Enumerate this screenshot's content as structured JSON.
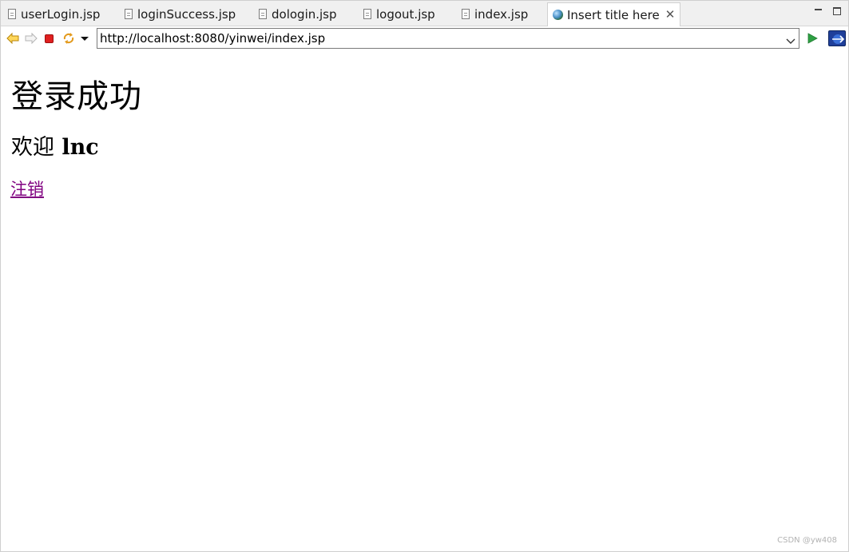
{
  "tabs": [
    {
      "label": "userLogin.jsp",
      "icon": "jsp-file-icon"
    },
    {
      "label": "loginSuccess.jsp",
      "icon": "jsp-file-icon"
    },
    {
      "label": "dologin.jsp",
      "icon": "jsp-file-icon"
    },
    {
      "label": "logout.jsp",
      "icon": "jsp-file-icon"
    },
    {
      "label": "index.jsp",
      "icon": "jsp-file-icon"
    },
    {
      "label": "Insert title here",
      "icon": "globe-icon",
      "active": true
    }
  ],
  "toolbar": {
    "url": "http://localhost:8080/yinwei/index.jsp",
    "icons": [
      "back-arrow",
      "forward-arrow",
      "stop",
      "refresh",
      "dropdown-arrow",
      "go",
      "browser"
    ]
  },
  "page": {
    "heading": "登录成功",
    "welcome_label": "欢迎",
    "username": "lnc",
    "logout_link": "注销"
  },
  "watermark": "CSDN @yw408",
  "colors": {
    "link_visited": "#800080",
    "stop_red": "#e02020",
    "go_green": "#2ea043",
    "tab_bar": "#f0f0f0"
  }
}
